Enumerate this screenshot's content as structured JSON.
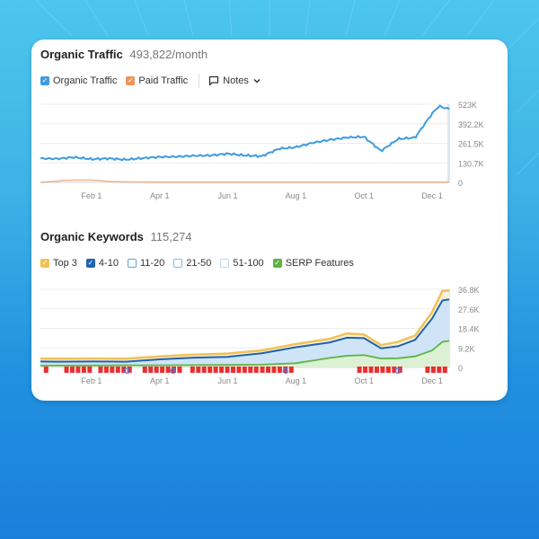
{
  "colors": {
    "organic": "#3d9be0",
    "paid": "#f0935a",
    "top3": "#f2c156",
    "pos4_10": "#1e63b0",
    "serp": "#5cb545",
    "area_blue": "#cfe4f6",
    "area_green": "#dcf0d4",
    "marker_red": "#e8302f"
  },
  "traffic": {
    "title": "Organic Traffic",
    "value": "493,822/month",
    "legend": [
      {
        "label": "Organic Traffic",
        "checked": true,
        "color": "#3d9be0"
      },
      {
        "label": "Paid Traffic",
        "checked": true,
        "color": "#f0935a"
      }
    ],
    "notes_label": "Notes"
  },
  "keywords": {
    "title": "Organic Keywords",
    "value": "115,274",
    "legend": [
      {
        "label": "Top 3",
        "checked": true,
        "color": "#f2c156"
      },
      {
        "label": "4-10",
        "checked": true,
        "color": "#1e63b0"
      },
      {
        "label": "11-20",
        "checked": false,
        "color": "#5aa7d8"
      },
      {
        "label": "21-50",
        "checked": false,
        "color": "#7fbde0"
      },
      {
        "label": "51-100",
        "checked": false,
        "color": "#bcd8ea"
      },
      {
        "label": "SERP Features",
        "checked": true,
        "color": "#5cb545"
      }
    ]
  },
  "chart_data": [
    {
      "type": "line",
      "title": "Organic Traffic",
      "x_ticks": [
        "Feb 1",
        "Apr 1",
        "Jun 1",
        "Aug 1",
        "Oct 1",
        "Dec 1"
      ],
      "y_ticks": [
        "0",
        "130.7K",
        "261.5K",
        "392.2K",
        "523K"
      ],
      "ylim": [
        0,
        523000
      ],
      "x_range_months": [
        0.5,
        12.5
      ],
      "grid": true,
      "series": [
        {
          "name": "Organic Traffic",
          "x": [
            0.5,
            1,
            1.5,
            2,
            2.5,
            3,
            3.5,
            4,
            4.5,
            5,
            5.5,
            6,
            6.5,
            7,
            7.5,
            8,
            8.5,
            9,
            9.5,
            10,
            10.5,
            11,
            11.5,
            12,
            12.2,
            12.5
          ],
          "values": [
            160000,
            158000,
            168000,
            155000,
            160000,
            152000,
            162000,
            170000,
            172000,
            178000,
            180000,
            192000,
            180000,
            175000,
            225000,
            235000,
            265000,
            285000,
            300000,
            305000,
            210000,
            290000,
            300000,
            460000,
            510000,
            490000
          ]
        },
        {
          "name": "Paid Traffic",
          "x": [
            0.5,
            1,
            1.2,
            1.5,
            2,
            2.3,
            2.6,
            3,
            4,
            6,
            8,
            10,
            12,
            12.5
          ],
          "values": [
            0,
            8000,
            14000,
            15000,
            15000,
            10000,
            5000,
            3000,
            2000,
            1500,
            1500,
            1500,
            1500,
            1500
          ]
        }
      ]
    },
    {
      "type": "area",
      "title": "Organic Keywords",
      "x_ticks": [
        "Feb 1",
        "Apr 1",
        "Jun 1",
        "Aug 1",
        "Oct 1",
        "Dec 1"
      ],
      "y_ticks": [
        "0",
        "9.2K",
        "18.4K",
        "27.6K",
        "36.8K"
      ],
      "ylim": [
        0,
        36800
      ],
      "x_range_months": [
        0.5,
        12.5
      ],
      "grid": true,
      "series": [
        {
          "name": "Top 3",
          "x": [
            0.5,
            1,
            2,
            3,
            4,
            5,
            6,
            7,
            8,
            9,
            9.5,
            10,
            10.5,
            11,
            11.5,
            12,
            12.3,
            12.5
          ],
          "values": [
            4200,
            4100,
            4200,
            4100,
            5200,
            6000,
            6500,
            8000,
            11000,
            13500,
            16000,
            15500,
            10500,
            12000,
            15000,
            26000,
            36000,
            36200
          ]
        },
        {
          "name": "4-10",
          "x": [
            0.5,
            1,
            2,
            3,
            4,
            5,
            6,
            7,
            8,
            9,
            9.5,
            10,
            10.5,
            11,
            11.5,
            12,
            12.3,
            12.5
          ],
          "values": [
            2800,
            2700,
            2800,
            2700,
            3800,
            4600,
            5000,
            6700,
            9500,
            11800,
            14000,
            13800,
            9000,
            10000,
            13000,
            23000,
            31500,
            32000
          ]
        },
        {
          "name": "SERP Features",
          "x": [
            0.5,
            1,
            2,
            3,
            4,
            5,
            6,
            7,
            8,
            8.5,
            9,
            9.5,
            10,
            10.5,
            11,
            11.5,
            12,
            12.3,
            12.5
          ],
          "values": [
            900,
            900,
            900,
            1000,
            1000,
            1100,
            1200,
            1300,
            2000,
            3200,
            4500,
            5500,
            5800,
            4200,
            4300,
            5200,
            8000,
            12000,
            12500
          ]
        }
      ],
      "annotation_markers": "red flag markers and Google update icons along x-axis"
    }
  ]
}
